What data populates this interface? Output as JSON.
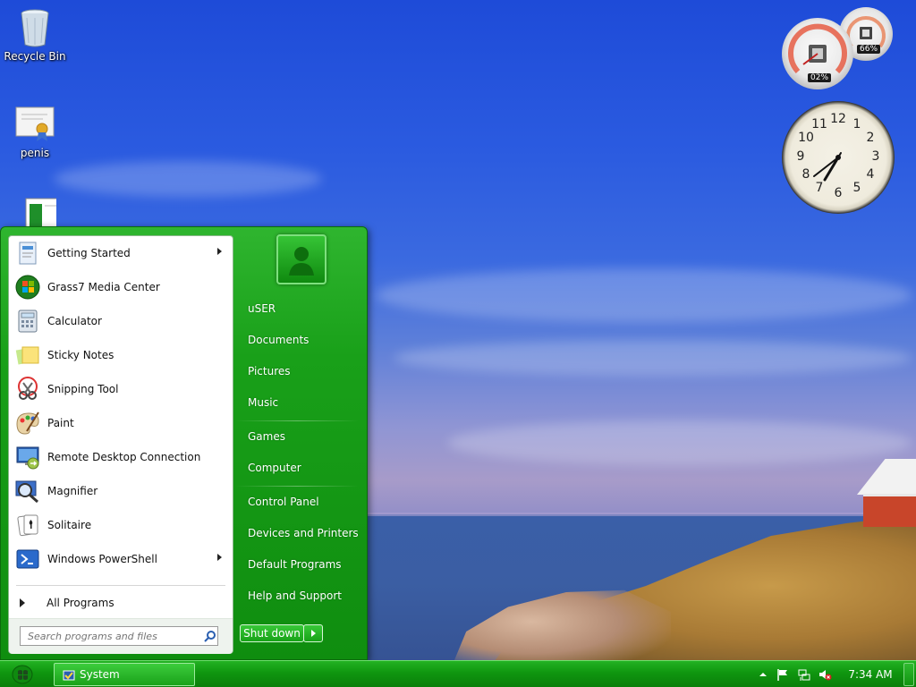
{
  "desktop": {
    "icons": [
      {
        "label": "Recycle Bin",
        "icon": "recycle-bin-icon"
      },
      {
        "label": "penis",
        "icon": "certificate-icon"
      },
      {
        "label": "",
        "icon": "document-icon"
      }
    ]
  },
  "gadgets": {
    "cpu_meter": {
      "cpu_readout": "02%",
      "memory_readout": "66%"
    },
    "clock": {
      "numbers": [
        "12",
        "1",
        "2",
        "3",
        "4",
        "5",
        "6",
        "7",
        "8",
        "9",
        "10",
        "11"
      ]
    }
  },
  "start_menu": {
    "programs": [
      {
        "label": "Getting Started",
        "icon": "getting-started-icon",
        "has_submenu": true
      },
      {
        "label": "Grass7 Media Center",
        "icon": "media-center-icon",
        "has_submenu": false
      },
      {
        "label": "Calculator",
        "icon": "calculator-icon",
        "has_submenu": false
      },
      {
        "label": "Sticky Notes",
        "icon": "sticky-notes-icon",
        "has_submenu": false
      },
      {
        "label": "Snipping Tool",
        "icon": "snipping-tool-icon",
        "has_submenu": false
      },
      {
        "label": "Paint",
        "icon": "paint-icon",
        "has_submenu": false
      },
      {
        "label": "Remote Desktop Connection",
        "icon": "remote-desktop-icon",
        "has_submenu": false
      },
      {
        "label": "Magnifier",
        "icon": "magnifier-icon",
        "has_submenu": false
      },
      {
        "label": "Solitaire",
        "icon": "solitaire-icon",
        "has_submenu": false
      },
      {
        "label": "Windows PowerShell",
        "icon": "powershell-icon",
        "has_submenu": true
      }
    ],
    "all_programs_label": "All Programs",
    "search_placeholder": "Search programs and files",
    "right_items": [
      {
        "label": "uSER",
        "name": "user"
      },
      {
        "label": "Documents",
        "name": "documents"
      },
      {
        "label": "Pictures",
        "name": "pictures"
      },
      {
        "label": "Music",
        "name": "music"
      },
      {
        "label": "Games",
        "name": "games"
      },
      {
        "label": "Computer",
        "name": "computer"
      },
      {
        "label": "Control Panel",
        "name": "control-panel"
      },
      {
        "label": "Devices and Printers",
        "name": "devices-and-printers"
      },
      {
        "label": "Default Programs",
        "name": "default-programs"
      },
      {
        "label": "Help and Support",
        "name": "help-and-support"
      }
    ],
    "shutdown_label": "Shut down"
  },
  "taskbar": {
    "window_button_label": "System",
    "clock": "7:34 AM"
  },
  "colors": {
    "accent_green": "#0f8d0f",
    "wallpaper_sky": "#2b5be0"
  }
}
